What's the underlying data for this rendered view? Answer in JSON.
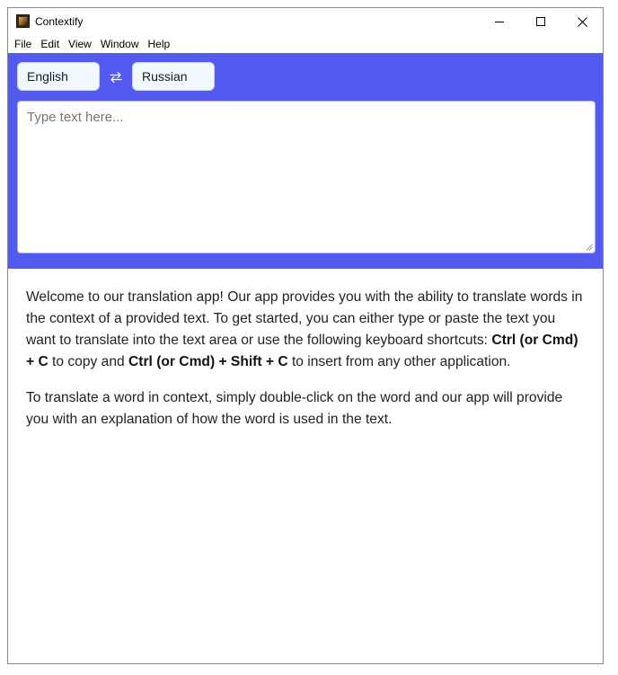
{
  "window": {
    "title": "Contextify",
    "icon": "app-icon"
  },
  "menu": [
    "File",
    "Edit",
    "View",
    "Window",
    "Help"
  ],
  "languages": {
    "source": "English",
    "target": "Russian",
    "swap_icon": "swap-arrows-icon"
  },
  "input": {
    "placeholder": "Type text here...",
    "value": ""
  },
  "help": {
    "p1_a": "Welcome to our translation app! Our app provides you with the ability to translate words in the context of a provided text. To get started, you can either type or paste the text you want to translate into the text area or use the following keyboard shortcuts: ",
    "shortcut_copy": "Ctrl (or Cmd) + C",
    "p1_b": " to copy and ",
    "shortcut_insert": "Ctrl (or Cmd) + Shift + C",
    "p1_c": " to insert from any other application.",
    "p2": "To translate a word in context, simply double-click on the word and our app will provide you with an explanation of how the word is used in the text."
  },
  "colors": {
    "header_bg": "#5459f0",
    "lang_bg": "#f0f9ff"
  }
}
